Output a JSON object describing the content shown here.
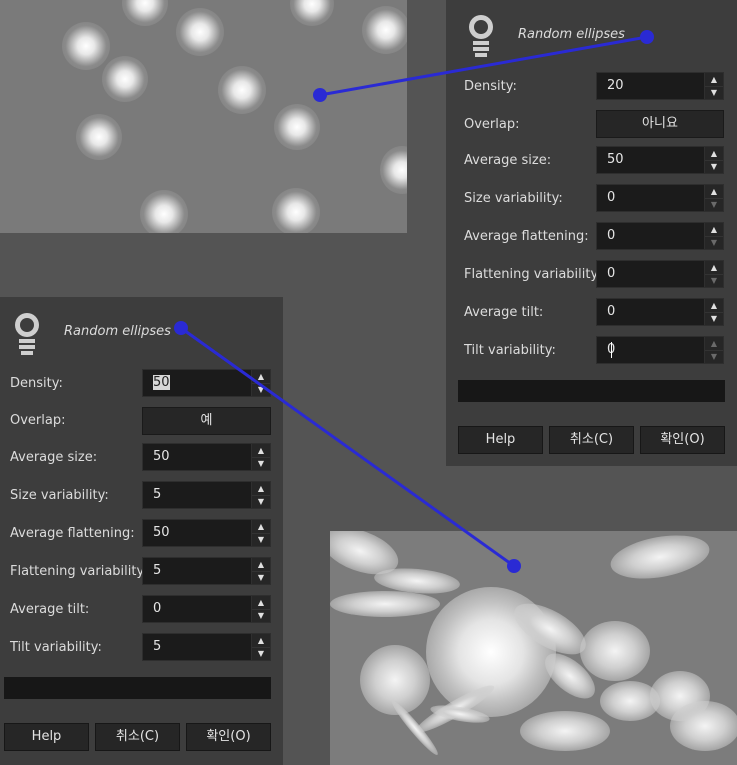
{
  "colors": {
    "background": "#545454",
    "dialog": "#3d3d3d",
    "connector": "#2a2ad4"
  },
  "dialog_top": {
    "title": "Random ellipses",
    "icon": "lightbulb-icon",
    "rows": [
      {
        "label": "Density:",
        "value": "20"
      },
      {
        "label": "Overlap:",
        "toggle": "아니요"
      },
      {
        "label": "Average size:",
        "value": "50"
      },
      {
        "label": "Size variability:",
        "value": "0"
      },
      {
        "label": "Average flattening:",
        "value": "0"
      },
      {
        "label": "Flattening variability:",
        "value": "0"
      },
      {
        "label": "Average tilt:",
        "value": "0"
      },
      {
        "label": "Tilt variability:",
        "value": "0"
      }
    ],
    "buttons": {
      "help": "Help",
      "cancel": "취소(C)",
      "ok": "확인(O)"
    }
  },
  "dialog_bottom": {
    "title": "Random ellipses",
    "icon": "lightbulb-icon",
    "rows": [
      {
        "label": "Density:",
        "value": "50"
      },
      {
        "label": "Overlap:",
        "toggle": "예"
      },
      {
        "label": "Average size:",
        "value": "50"
      },
      {
        "label": "Size variability:",
        "value": "5"
      },
      {
        "label": "Average flattening:",
        "value": "50"
      },
      {
        "label": "Flattening variability:",
        "value": "5"
      },
      {
        "label": "Average tilt:",
        "value": "0"
      },
      {
        "label": "Tilt variability:",
        "value": "5"
      }
    ],
    "buttons": {
      "help": "Help",
      "cancel": "취소(C)",
      "ok": "확인(O)"
    }
  }
}
